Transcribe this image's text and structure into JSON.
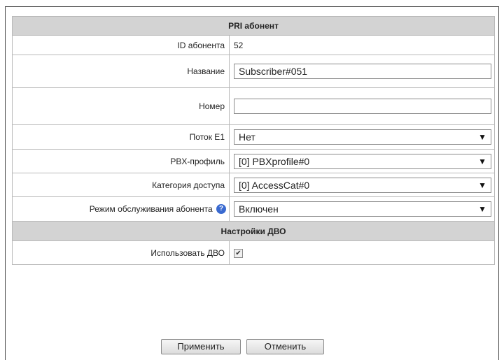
{
  "section_title": "PRI абонент",
  "fields": {
    "id_label": "ID абонента",
    "id_value": "52",
    "name_label": "Название",
    "name_value": "Subscriber#051",
    "number_label": "Номер",
    "number_value": "",
    "stream_label": "Поток E1",
    "stream_value": "Нет",
    "pbx_label": "PBX-профиль",
    "pbx_value": "[0] PBXprofile#0",
    "access_label": "Категория доступа",
    "access_value": "[0] AccessCat#0",
    "mode_label": "Режим обслуживания абонента",
    "mode_value": "Включен",
    "help_icon": "question-icon"
  },
  "dvo": {
    "title": "Настройки ДВО",
    "use_label": "Использовать ДВО",
    "use_checked": true
  },
  "buttons": {
    "apply": "Применить",
    "cancel": "Отменить"
  }
}
